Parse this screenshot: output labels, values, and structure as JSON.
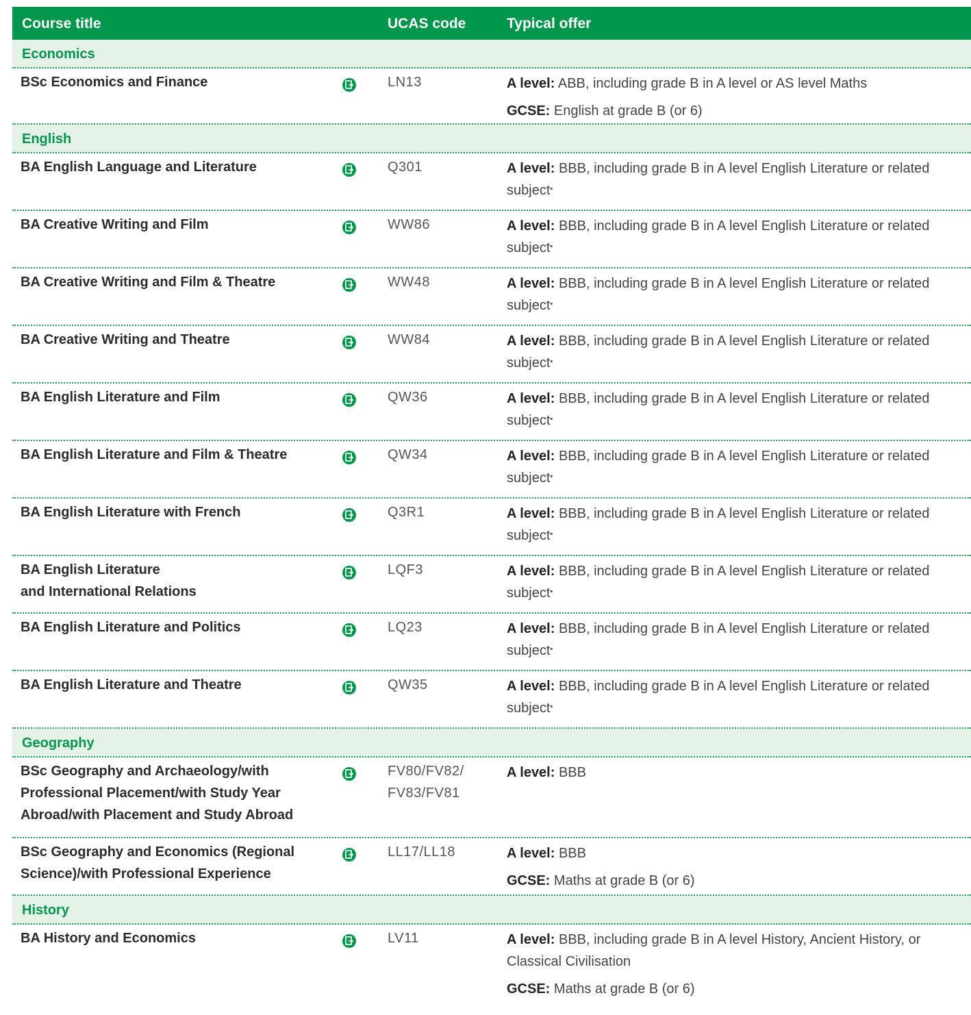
{
  "header": {
    "course_title": "Course title",
    "ucas_code": "UCAS code",
    "typical_offer": "Typical offer"
  },
  "brand_color": "#00964b",
  "row_icon": "document-arrow-icon",
  "sections": [
    {
      "name": "Economics",
      "rows": [
        {
          "title": "BSc Economics and Finance",
          "code": "LN13",
          "offers": [
            {
              "label": "A level:",
              "text": "ABB, including grade B in A level or AS level Maths"
            },
            {
              "label": "GCSE:",
              "text": "English at grade B (or 6)"
            }
          ]
        }
      ]
    },
    {
      "name": "English",
      "rows": [
        {
          "title": "BA English Language and Literature",
          "code": "Q301",
          "offers": [
            {
              "label": "A level:",
              "text": "BBB, including grade B in A level English Literature or related subject",
              "mark": "•"
            }
          ]
        },
        {
          "title": "BA Creative Writing and Film",
          "code": "WW86",
          "offers": [
            {
              "label": "A level:",
              "text": "BBB, including grade B in A level English Literature or related subject",
              "mark": "•"
            }
          ]
        },
        {
          "title": "BA Creative Writing and Film & Theatre",
          "code": "WW48",
          "offers": [
            {
              "label": "A level:",
              "text": "BBB, including grade B in A level English Literature or related subject",
              "mark": "•"
            }
          ]
        },
        {
          "title": "BA Creative Writing and Theatre",
          "code": "WW84",
          "offers": [
            {
              "label": "A level:",
              "text": "BBB, including grade B in A level English Literature or related subject",
              "mark": "•"
            }
          ]
        },
        {
          "title": "BA English Literature and Film",
          "code": "QW36",
          "offers": [
            {
              "label": "A level:",
              "text": "BBB, including grade B in A level English Literature or related subject",
              "mark": "•"
            }
          ]
        },
        {
          "title": "BA English Literature and Film & Theatre",
          "code": "QW34",
          "offers": [
            {
              "label": "A level:",
              "text": "BBB, including grade B in A level English Literature or related subject",
              "mark": "•"
            }
          ]
        },
        {
          "title": "BA English Literature with French",
          "code": "Q3R1",
          "offers": [
            {
              "label": "A level:",
              "text": "BBB, including grade B in A level English Literature or related subject",
              "mark": "•"
            }
          ]
        },
        {
          "title": "BA English Literature\nand International Relations",
          "code": "LQF3",
          "offers": [
            {
              "label": "A level:",
              "text": "BBB, including grade B in A level English Literature or related subject",
              "mark": "•"
            }
          ]
        },
        {
          "title": "BA English Literature and Politics",
          "code": "LQ23",
          "offers": [
            {
              "label": "A level:",
              "text": "BBB, including grade B in A level English Literature or related subject",
              "mark": "•"
            }
          ]
        },
        {
          "title": "BA English Literature and Theatre",
          "code": "QW35",
          "offers": [
            {
              "label": "A level:",
              "text": "BBB, including grade B in A level English Literature or related subject",
              "mark": "•"
            }
          ]
        }
      ]
    },
    {
      "name": "Geography",
      "rows": [
        {
          "title": "BSc Geography and Archaeology/with Professional Placement/with Study Year Abroad/with Placement and Study Abroad",
          "code": "FV80/FV82/ FV83/FV81",
          "offers": [
            {
              "label": "A level:",
              "text": "BBB"
            }
          ]
        },
        {
          "title": "BSc Geography and Economics (Regional Science)/with Professional Experience",
          "code": "LL17/LL18",
          "offers": [
            {
              "label": "A level:",
              "text": "BBB"
            },
            {
              "label": "GCSE:",
              "text": "Maths at grade B (or 6)"
            }
          ]
        }
      ]
    },
    {
      "name": "History",
      "rows": [
        {
          "title": "BA History and Economics",
          "code": "LV11",
          "offers": [
            {
              "label": "A level:",
              "text": "BBB, including grade B in A level History, Ancient History, or Classical Civilisation"
            },
            {
              "label": "GCSE:",
              "text": "Maths at grade B (or 6)"
            }
          ]
        }
      ]
    }
  ]
}
